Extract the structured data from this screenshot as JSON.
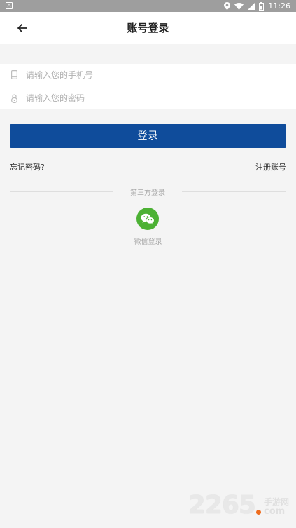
{
  "status_bar": {
    "time": "11:26",
    "left_icon": "notification-a-icon",
    "icons": [
      "location-icon",
      "wifi-icon",
      "signal-icon",
      "battery-icon"
    ]
  },
  "header": {
    "title": "账号登录",
    "back_icon": "arrow-left-icon"
  },
  "form": {
    "phone_placeholder": "请输入您的手机号",
    "phone_value": "",
    "password_placeholder": "请输入您的密码",
    "password_value": "",
    "login_label": "登录"
  },
  "links": {
    "forgot": "忘记密码?",
    "register": "注册账号"
  },
  "third_party": {
    "label": "第三方登录",
    "wechat_label": "微信登录"
  },
  "watermark": {
    "digits_a": "22",
    "digits_b": "65",
    "cn": "手游网",
    "com": "com"
  },
  "colors": {
    "primary": "#0f4c9b",
    "wechat": "#4cb134",
    "background": "#f4f4f4",
    "status_bar": "#9e9e9e"
  }
}
